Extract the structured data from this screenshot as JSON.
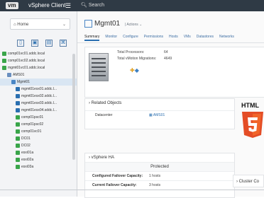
{
  "topbar": {
    "logo": "vm",
    "title": "vSphere Client",
    "search": "Search"
  },
  "sidebar": {
    "home": "Home",
    "tree": [
      {
        "label": "comp01vc01.sddc.local",
        "color": "#3aa54a"
      },
      {
        "label": "comp01vc02.sddc.local",
        "color": "#3aa54a"
      },
      {
        "label": "mgmt01vc01.sddc.local",
        "color": "#3aa54a"
      },
      {
        "label": "AMS01",
        "color": "#6a8fbf"
      },
      {
        "label": "Mgmt01",
        "color": "#4a86c5"
      },
      {
        "label": "mgmt01esx01.sddc.l...",
        "color": "#2a6fb0"
      },
      {
        "label": "mgmt01esx02.sddc.l...",
        "color": "#2a6fb0"
      },
      {
        "label": "mgmt01esx03.sddc.l...",
        "color": "#2a6fb0"
      },
      {
        "label": "mgmt01esx04.sddc.l...",
        "color": "#2a6fb0"
      },
      {
        "label": "comp01psc01",
        "color": "#3aa54a"
      },
      {
        "label": "comp01psc02",
        "color": "#3aa54a"
      },
      {
        "label": "comp01vc01",
        "color": "#3aa54a"
      },
      {
        "label": "DC01",
        "color": "#3aa54a"
      },
      {
        "label": "DC02",
        "color": "#3aa54a"
      },
      {
        "label": "esxi01a",
        "color": "#3aa54a"
      },
      {
        "label": "esxi02a",
        "color": "#3aa54a"
      },
      {
        "label": "esxi03a",
        "color": "#3aa54a"
      }
    ]
  },
  "main": {
    "title": "Mgmt01",
    "actions": "Actions",
    "tabs": [
      "Summary",
      "Monitor",
      "Configure",
      "Permissions",
      "Hosts",
      "VMs",
      "Datastores",
      "Networks"
    ],
    "summary": {
      "total_processors_label": "Total Processors:",
      "total_processors": "64",
      "vmotion_label": "Total vMotion Migrations:",
      "vmotion": "4649"
    },
    "related": {
      "title": "Related Objects",
      "datacenter_label": "Datacenter",
      "datacenter_value": "AMS01"
    },
    "ha": {
      "title": "vSphere HA",
      "protected": "Protected",
      "rows": [
        {
          "k": "Configured Failover Capacity:",
          "v": "1 hosts"
        },
        {
          "k": "Current Failover Capacity:",
          "v": "3 hosts"
        }
      ]
    },
    "cluster": "Cluster Co"
  },
  "overlay": {
    "html5": "HTML"
  }
}
